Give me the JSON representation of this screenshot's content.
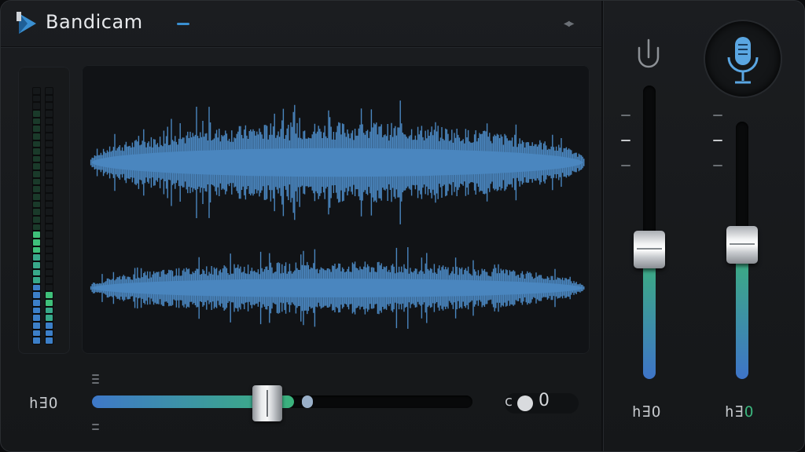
{
  "app": {
    "brand": "Bandicam",
    "brand_icon": "bandicam-logo-icon",
    "header_icon": "collapse-arrows-icon"
  },
  "colors": {
    "accent_blue": "#3a8fd1",
    "wave_blue": "#4a86bf",
    "meter_green": "#3bb37c",
    "slider_gradient_start": "#3e78c9",
    "slider_gradient_end": "#3bb37c"
  },
  "left_meter": {
    "level_left": 0.45,
    "level_right": 0.2
  },
  "waveform": {
    "icon": "waveform-icon",
    "channels": 2
  },
  "main_slider": {
    "label": "h∃O",
    "value": 0.53,
    "toggle_prefix": "c",
    "toggle_value": "0"
  },
  "system_slider": {
    "icon": "usb-icon",
    "label": "h∃O",
    "value": 0.44,
    "meter_level": 0.49
  },
  "mic_slider": {
    "icon": "microphone-icon",
    "label_prefix": "h∃",
    "label_suffix": "O",
    "value": 0.52
  }
}
